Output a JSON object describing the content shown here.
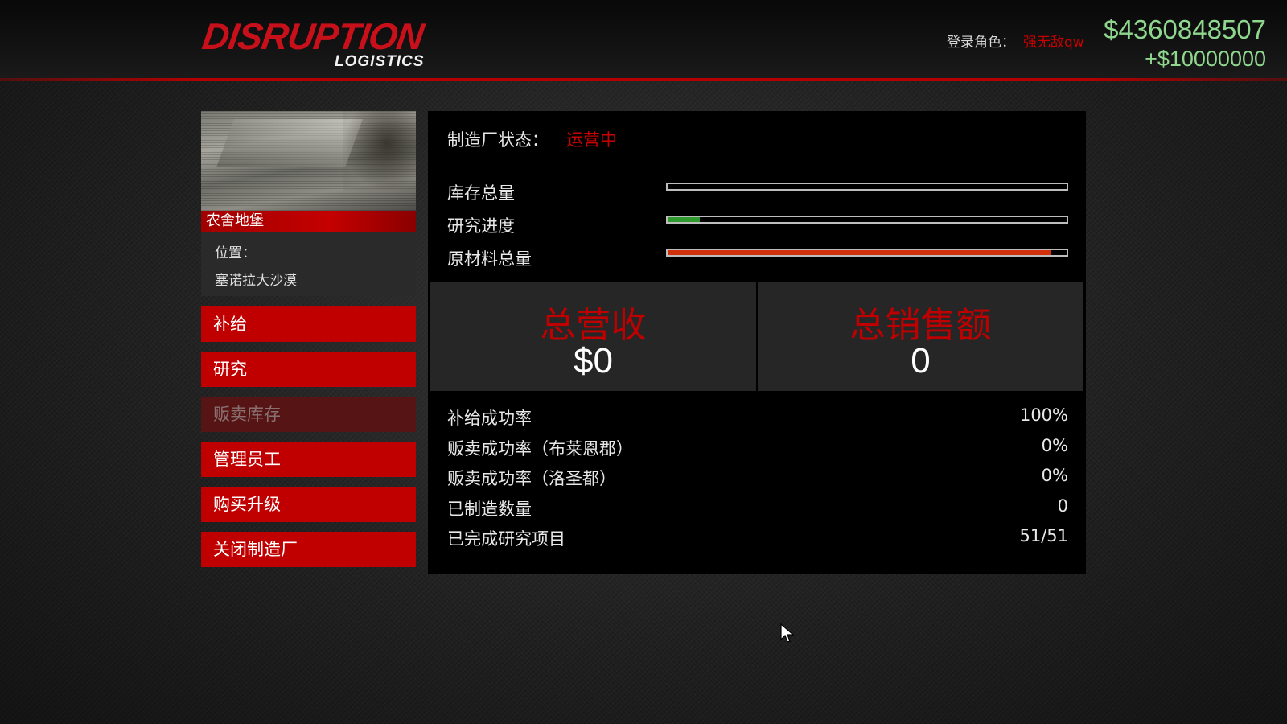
{
  "header": {
    "logo_main": "DISRUPTION",
    "logo_sub": "LOGISTICS",
    "login_label": "登录角色：",
    "login_name": "强无敌qw",
    "money": "$4360848507",
    "money_add": "+$10000000"
  },
  "property": {
    "name": "农舍地堡",
    "location_label": "位置：",
    "location": "塞诺拉大沙漠"
  },
  "menu": [
    {
      "label": "补给",
      "enabled": true
    },
    {
      "label": "研究",
      "enabled": true
    },
    {
      "label": "贩卖库存",
      "enabled": false
    },
    {
      "label": "管理员工",
      "enabled": true
    },
    {
      "label": "购买升级",
      "enabled": true
    },
    {
      "label": "关闭制造厂",
      "enabled": true
    }
  ],
  "status": {
    "label": "制造厂状态：",
    "value": "运营中"
  },
  "bars": [
    {
      "label": "库存总量",
      "progress": 0,
      "color": "#ffffff"
    },
    {
      "label": "研究进度",
      "progress": 0.08,
      "color": "#2e9a2e"
    },
    {
      "label": "原材料总量",
      "progress": 0.96,
      "color": "#d0300a"
    }
  ],
  "totals": {
    "revenue_label": "总营收",
    "revenue_value": "$0",
    "sales_label": "总销售额",
    "sales_value": "0"
  },
  "rows": [
    {
      "label": "补给成功率",
      "value": "100%"
    },
    {
      "label": "贩卖成功率（布莱恩郡）",
      "value": "0%"
    },
    {
      "label": "贩卖成功率（洛圣都）",
      "value": "0%"
    },
    {
      "label": "已制造数量",
      "value": "0"
    },
    {
      "label": "已完成研究项目",
      "value": "51/51"
    }
  ],
  "colors": {
    "accent_red": "#c00000",
    "money_green": "#8fd68f"
  }
}
